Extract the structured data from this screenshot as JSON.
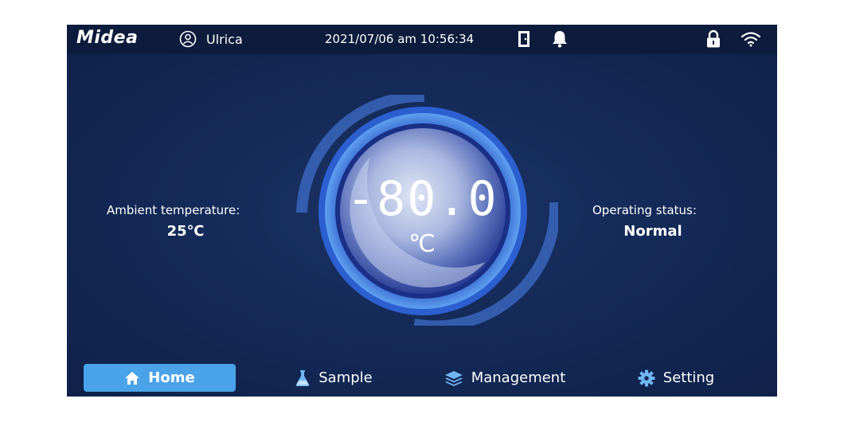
{
  "status_bar": {
    "logo": "Midea",
    "user_name": "Ulrica",
    "datetime": "2021/07/06  am  10:56:34",
    "icons": [
      "user-icon",
      "door-icon",
      "bell-icon",
      "lock-icon",
      "wifi-icon"
    ]
  },
  "ambient": {
    "label": "Ambient temperature:",
    "value": "25℃"
  },
  "operating": {
    "label": "Operating status:",
    "value": "Normal"
  },
  "gauge": {
    "temperature": "-80.0",
    "unit": "℃"
  },
  "nav": {
    "items": [
      {
        "label": "Home",
        "icon": "home-icon",
        "active": true
      },
      {
        "label": "Sample",
        "icon": "flask-icon",
        "active": false
      },
      {
        "label": "Management",
        "icon": "layers-icon",
        "active": false
      },
      {
        "label": "Setting",
        "icon": "gear-icon",
        "active": false
      }
    ]
  },
  "colors": {
    "background": "#142a58",
    "status_bar": "#0d1b3c",
    "active_nav": "#4aa2e8",
    "ring": "#3b6fd1"
  }
}
